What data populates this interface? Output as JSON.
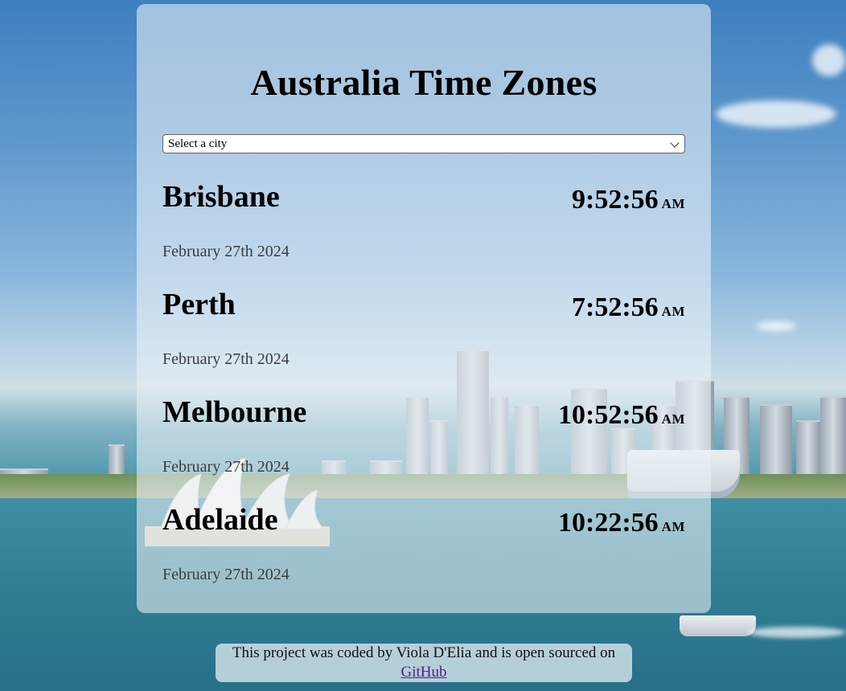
{
  "title": "Australia Time Zones",
  "city_select": {
    "selected": "Select a city"
  },
  "cities": [
    {
      "name": "Brisbane",
      "time": "9:52:56",
      "ampm": "AM",
      "date": "February 27th 2024"
    },
    {
      "name": "Perth",
      "time": "7:52:56",
      "ampm": "AM",
      "date": "February 27th 2024"
    },
    {
      "name": "Melbourne",
      "time": "10:52:56",
      "ampm": "AM",
      "date": "February 27th 2024"
    },
    {
      "name": "Adelaide",
      "time": "10:22:56",
      "ampm": "AM",
      "date": "February 27th 2024"
    }
  ],
  "footer": {
    "text_before": "This project was coded by Viola D'Elia and is open sourced on ",
    "link_label": "GitHub"
  },
  "colors": {
    "link": "#551a8b",
    "card_bg": "rgba(235,242,246,0.58)"
  },
  "background": {
    "icon": "sydney-harbour-photo"
  }
}
